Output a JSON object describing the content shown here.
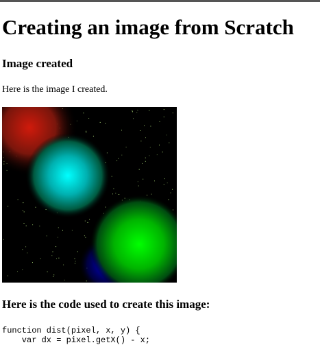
{
  "page": {
    "title": "Creating an image from Scratch",
    "section_created": "Image created",
    "intro_text": "Here is the image I created.",
    "section_code": "Here is the code used to create this image:"
  },
  "image": {
    "background": "#000000",
    "orbs": [
      {
        "name": "red-orb",
        "color": "#c0180a"
      },
      {
        "name": "cyan-orb",
        "color": "#00ffff"
      },
      {
        "name": "green-orb",
        "color": "#00ff00"
      }
    ],
    "star_color": "#c8ff8c"
  },
  "code": {
    "lines": [
      "function dist(pixel, x, y) {",
      "    var dx = pixel.getX() - x;"
    ]
  }
}
